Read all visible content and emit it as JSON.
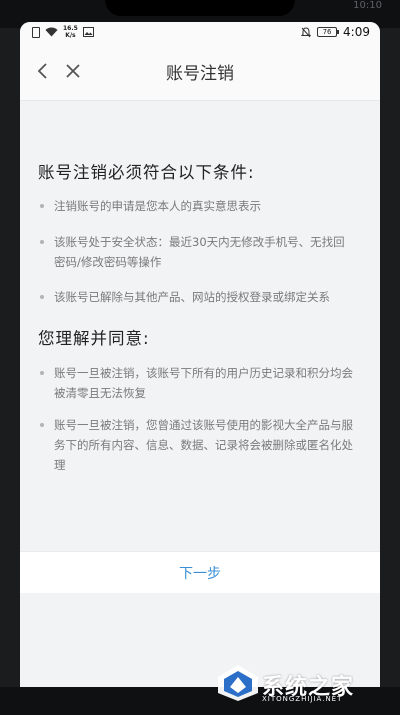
{
  "device": {
    "top_time_faint": "10:10"
  },
  "status_bar": {
    "net_speed_value": "16.5",
    "net_speed_unit": "K/s",
    "battery": "76",
    "time": "4:09"
  },
  "nav": {
    "title": "账号注销"
  },
  "conditions": {
    "heading": "账号注销必须符合以下条件:",
    "items": [
      "注销账号的申请是您本人的真实意思表示",
      "该账号处于安全状态：最近30天内无修改手机号、无找回密码/修改密码等操作",
      "该账号已解除与其他产品、网站的授权登录或绑定关系"
    ]
  },
  "agreement": {
    "heading": "您理解并同意:",
    "items": [
      "账号一旦被注销，该账号下所有的用户历史记录和积分均会被清零且无法恢复",
      "账号一旦被注销，您曾通过该账号使用的影视大全产品与服务下的所有内容、信息、数据、记录将会被删除或匿名化处理"
    ]
  },
  "footer": {
    "next_label": "下一步"
  },
  "watermark": {
    "title": "系统之家",
    "url": "XITONGZHIJIA.NET"
  },
  "colors": {
    "accent": "#3a8fd6",
    "background": "#f2f3f5",
    "bullet_text": "#7a7a7a"
  }
}
